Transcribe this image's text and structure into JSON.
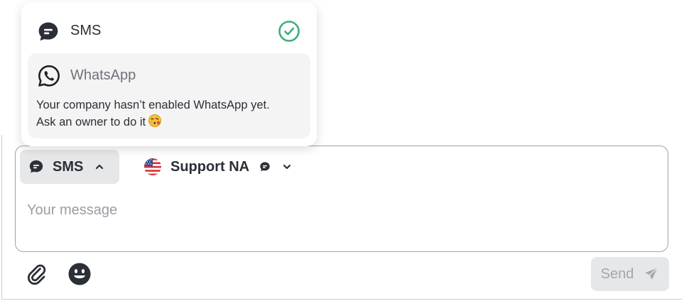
{
  "dropdown": {
    "options": [
      {
        "label": "SMS",
        "icon": "sms-bubble-icon",
        "selected": true
      },
      {
        "label": "WhatsApp",
        "icon": "whatsapp-icon",
        "disabled": true
      }
    ],
    "whatsapp_notice_line1": "Your company hasn’t enabled WhatsApp yet.",
    "whatsapp_notice_line2": "Ask an owner to do it"
  },
  "composer": {
    "channel_label": "SMS",
    "sender_label": "Support NA",
    "message_placeholder": "Your message",
    "message_value": "",
    "send_label": "Send"
  },
  "colors": {
    "check_green": "#3daf7b",
    "dark_icon": "#2b2f36",
    "muted_text": "#9a9da3",
    "button_bg": "#e6e7e9"
  }
}
